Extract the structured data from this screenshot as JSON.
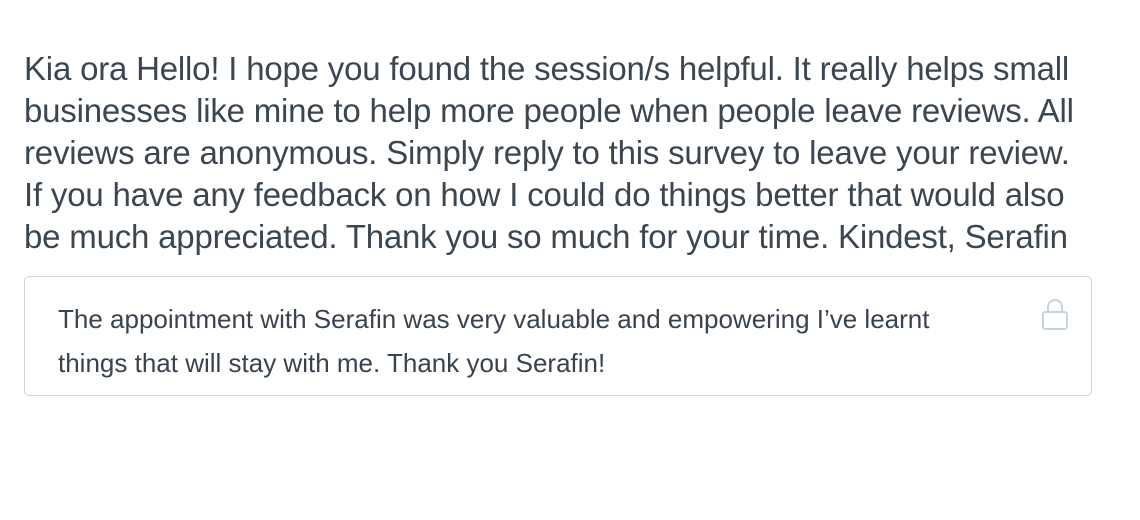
{
  "survey": {
    "prompt": "Kia ora Hello! I hope you found the session/s helpful. It really helps small businesses like mine to help more people when people leave reviews. All reviews are anonymous. Simply reply to this survey to leave your review. If you have any feedback on how I could do things better that would also be much appreciated. Thank you so much for your time. Kindest, Serafin",
    "response": "The appointment with Serafin was very valuable and empowering I’ve learnt things that will stay with me. Thank you Serafin!",
    "response_icon": "lock-icon"
  },
  "colors": {
    "text": "#3b4651",
    "box_border": "#c6d4e0",
    "icon": "#c6d4e0"
  }
}
